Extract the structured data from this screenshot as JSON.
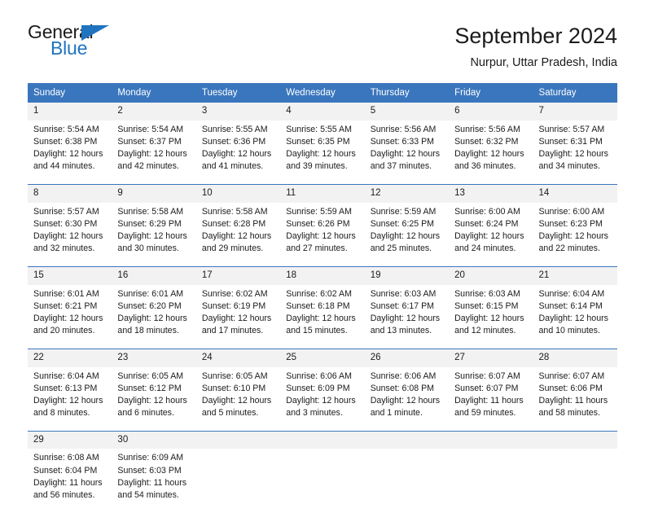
{
  "brand": {
    "name_part1": "General",
    "name_part2": "Blue",
    "triangle_icon": "triangle-icon",
    "accent_color": "#1f74c0"
  },
  "header": {
    "title": "September 2024",
    "location": "Nurpur, Uttar Pradesh, India"
  },
  "calendar": {
    "header_color": "#3a76bd",
    "daynum_band_color": "#f2f2f2",
    "weekdays": [
      "Sunday",
      "Monday",
      "Tuesday",
      "Wednesday",
      "Thursday",
      "Friday",
      "Saturday"
    ],
    "weeks": [
      [
        {
          "day": "1",
          "sunrise": "Sunrise: 5:54 AM",
          "sunset": "Sunset: 6:38 PM",
          "daylight_l1": "Daylight: 12 hours",
          "daylight_l2": "and 44 minutes."
        },
        {
          "day": "2",
          "sunrise": "Sunrise: 5:54 AM",
          "sunset": "Sunset: 6:37 PM",
          "daylight_l1": "Daylight: 12 hours",
          "daylight_l2": "and 42 minutes."
        },
        {
          "day": "3",
          "sunrise": "Sunrise: 5:55 AM",
          "sunset": "Sunset: 6:36 PM",
          "daylight_l1": "Daylight: 12 hours",
          "daylight_l2": "and 41 minutes."
        },
        {
          "day": "4",
          "sunrise": "Sunrise: 5:55 AM",
          "sunset": "Sunset: 6:35 PM",
          "daylight_l1": "Daylight: 12 hours",
          "daylight_l2": "and 39 minutes."
        },
        {
          "day": "5",
          "sunrise": "Sunrise: 5:56 AM",
          "sunset": "Sunset: 6:33 PM",
          "daylight_l1": "Daylight: 12 hours",
          "daylight_l2": "and 37 minutes."
        },
        {
          "day": "6",
          "sunrise": "Sunrise: 5:56 AM",
          "sunset": "Sunset: 6:32 PM",
          "daylight_l1": "Daylight: 12 hours",
          "daylight_l2": "and 36 minutes."
        },
        {
          "day": "7",
          "sunrise": "Sunrise: 5:57 AM",
          "sunset": "Sunset: 6:31 PM",
          "daylight_l1": "Daylight: 12 hours",
          "daylight_l2": "and 34 minutes."
        }
      ],
      [
        {
          "day": "8",
          "sunrise": "Sunrise: 5:57 AM",
          "sunset": "Sunset: 6:30 PM",
          "daylight_l1": "Daylight: 12 hours",
          "daylight_l2": "and 32 minutes."
        },
        {
          "day": "9",
          "sunrise": "Sunrise: 5:58 AM",
          "sunset": "Sunset: 6:29 PM",
          "daylight_l1": "Daylight: 12 hours",
          "daylight_l2": "and 30 minutes."
        },
        {
          "day": "10",
          "sunrise": "Sunrise: 5:58 AM",
          "sunset": "Sunset: 6:28 PM",
          "daylight_l1": "Daylight: 12 hours",
          "daylight_l2": "and 29 minutes."
        },
        {
          "day": "11",
          "sunrise": "Sunrise: 5:59 AM",
          "sunset": "Sunset: 6:26 PM",
          "daylight_l1": "Daylight: 12 hours",
          "daylight_l2": "and 27 minutes."
        },
        {
          "day": "12",
          "sunrise": "Sunrise: 5:59 AM",
          "sunset": "Sunset: 6:25 PM",
          "daylight_l1": "Daylight: 12 hours",
          "daylight_l2": "and 25 minutes."
        },
        {
          "day": "13",
          "sunrise": "Sunrise: 6:00 AM",
          "sunset": "Sunset: 6:24 PM",
          "daylight_l1": "Daylight: 12 hours",
          "daylight_l2": "and 24 minutes."
        },
        {
          "day": "14",
          "sunrise": "Sunrise: 6:00 AM",
          "sunset": "Sunset: 6:23 PM",
          "daylight_l1": "Daylight: 12 hours",
          "daylight_l2": "and 22 minutes."
        }
      ],
      [
        {
          "day": "15",
          "sunrise": "Sunrise: 6:01 AM",
          "sunset": "Sunset: 6:21 PM",
          "daylight_l1": "Daylight: 12 hours",
          "daylight_l2": "and 20 minutes."
        },
        {
          "day": "16",
          "sunrise": "Sunrise: 6:01 AM",
          "sunset": "Sunset: 6:20 PM",
          "daylight_l1": "Daylight: 12 hours",
          "daylight_l2": "and 18 minutes."
        },
        {
          "day": "17",
          "sunrise": "Sunrise: 6:02 AM",
          "sunset": "Sunset: 6:19 PM",
          "daylight_l1": "Daylight: 12 hours",
          "daylight_l2": "and 17 minutes."
        },
        {
          "day": "18",
          "sunrise": "Sunrise: 6:02 AM",
          "sunset": "Sunset: 6:18 PM",
          "daylight_l1": "Daylight: 12 hours",
          "daylight_l2": "and 15 minutes."
        },
        {
          "day": "19",
          "sunrise": "Sunrise: 6:03 AM",
          "sunset": "Sunset: 6:17 PM",
          "daylight_l1": "Daylight: 12 hours",
          "daylight_l2": "and 13 minutes."
        },
        {
          "day": "20",
          "sunrise": "Sunrise: 6:03 AM",
          "sunset": "Sunset: 6:15 PM",
          "daylight_l1": "Daylight: 12 hours",
          "daylight_l2": "and 12 minutes."
        },
        {
          "day": "21",
          "sunrise": "Sunrise: 6:04 AM",
          "sunset": "Sunset: 6:14 PM",
          "daylight_l1": "Daylight: 12 hours",
          "daylight_l2": "and 10 minutes."
        }
      ],
      [
        {
          "day": "22",
          "sunrise": "Sunrise: 6:04 AM",
          "sunset": "Sunset: 6:13 PM",
          "daylight_l1": "Daylight: 12 hours",
          "daylight_l2": "and 8 minutes."
        },
        {
          "day": "23",
          "sunrise": "Sunrise: 6:05 AM",
          "sunset": "Sunset: 6:12 PM",
          "daylight_l1": "Daylight: 12 hours",
          "daylight_l2": "and 6 minutes."
        },
        {
          "day": "24",
          "sunrise": "Sunrise: 6:05 AM",
          "sunset": "Sunset: 6:10 PM",
          "daylight_l1": "Daylight: 12 hours",
          "daylight_l2": "and 5 minutes."
        },
        {
          "day": "25",
          "sunrise": "Sunrise: 6:06 AM",
          "sunset": "Sunset: 6:09 PM",
          "daylight_l1": "Daylight: 12 hours",
          "daylight_l2": "and 3 minutes."
        },
        {
          "day": "26",
          "sunrise": "Sunrise: 6:06 AM",
          "sunset": "Sunset: 6:08 PM",
          "daylight_l1": "Daylight: 12 hours",
          "daylight_l2": "and 1 minute."
        },
        {
          "day": "27",
          "sunrise": "Sunrise: 6:07 AM",
          "sunset": "Sunset: 6:07 PM",
          "daylight_l1": "Daylight: 11 hours",
          "daylight_l2": "and 59 minutes."
        },
        {
          "day": "28",
          "sunrise": "Sunrise: 6:07 AM",
          "sunset": "Sunset: 6:06 PM",
          "daylight_l1": "Daylight: 11 hours",
          "daylight_l2": "and 58 minutes."
        }
      ],
      [
        {
          "day": "29",
          "sunrise": "Sunrise: 6:08 AM",
          "sunset": "Sunset: 6:04 PM",
          "daylight_l1": "Daylight: 11 hours",
          "daylight_l2": "and 56 minutes."
        },
        {
          "day": "30",
          "sunrise": "Sunrise: 6:09 AM",
          "sunset": "Sunset: 6:03 PM",
          "daylight_l1": "Daylight: 11 hours",
          "daylight_l2": "and 54 minutes."
        },
        {
          "day": "",
          "sunrise": "",
          "sunset": "",
          "daylight_l1": "",
          "daylight_l2": ""
        },
        {
          "day": "",
          "sunrise": "",
          "sunset": "",
          "daylight_l1": "",
          "daylight_l2": ""
        },
        {
          "day": "",
          "sunrise": "",
          "sunset": "",
          "daylight_l1": "",
          "daylight_l2": ""
        },
        {
          "day": "",
          "sunrise": "",
          "sunset": "",
          "daylight_l1": "",
          "daylight_l2": ""
        },
        {
          "day": "",
          "sunrise": "",
          "sunset": "",
          "daylight_l1": "",
          "daylight_l2": ""
        }
      ]
    ]
  }
}
